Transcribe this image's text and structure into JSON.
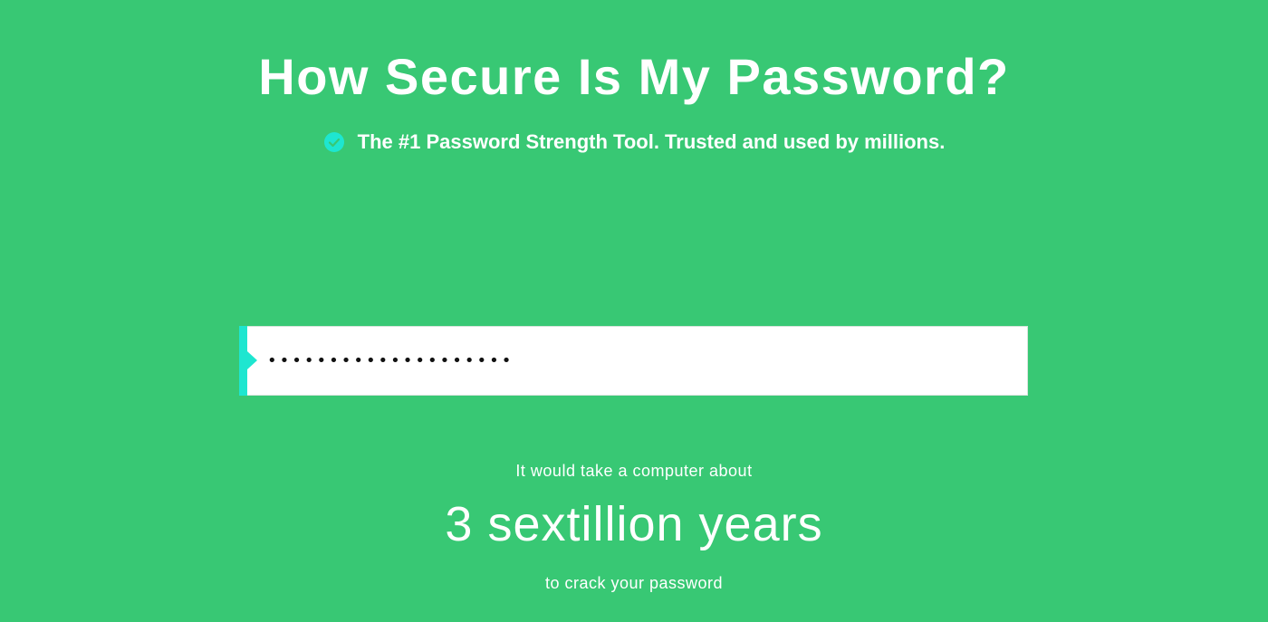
{
  "header": {
    "title": "How Secure Is My Password?",
    "tagline": "The #1 Password Strength Tool. Trusted and used by millions.",
    "tagline_icon": "verified-badge-icon"
  },
  "password_field": {
    "value": "••••••••••••••••••••",
    "type": "password"
  },
  "result": {
    "prefix": "It would take a computer about",
    "time": "3 sextillion years",
    "suffix": "to crack your password"
  },
  "colors": {
    "background": "#38c874",
    "accent": "#1ee6d0",
    "text": "#ffffff"
  }
}
